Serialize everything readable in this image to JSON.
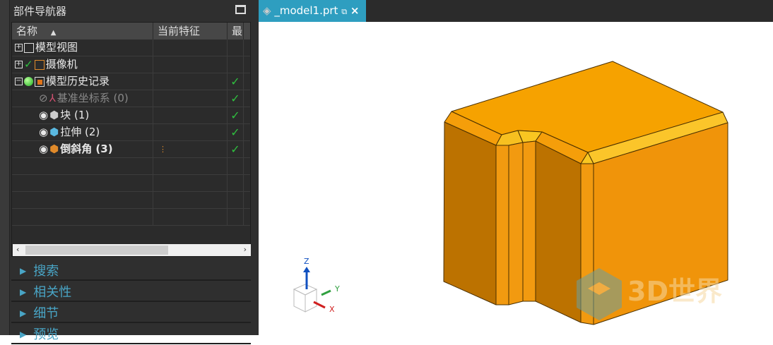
{
  "navigator": {
    "title": "部件导航器",
    "columns": [
      "名称",
      "当前特征",
      "最"
    ],
    "rows": [
      {
        "label": "模型视图",
        "latest": ""
      },
      {
        "label": "摄像机",
        "latest": ""
      },
      {
        "label": "模型历史记录",
        "latest": "✓"
      },
      {
        "label": "基准坐标系 (0)",
        "latest": "✓"
      },
      {
        "label": "块 (1)",
        "latest": "✓"
      },
      {
        "label": "拉伸 (2)",
        "latest": "✓"
      },
      {
        "label": "倒斜角 (3)",
        "latest": "✓"
      }
    ],
    "sections": [
      "搜索",
      "相关性",
      "细节",
      "预览"
    ]
  },
  "tab": {
    "label": "_model1.prt"
  },
  "triad": {
    "z": "Z",
    "y": "Y",
    "x": "X"
  },
  "watermark": "3D世界",
  "colors": {
    "accent": "#2e9ec0",
    "model": "#f0960f"
  }
}
